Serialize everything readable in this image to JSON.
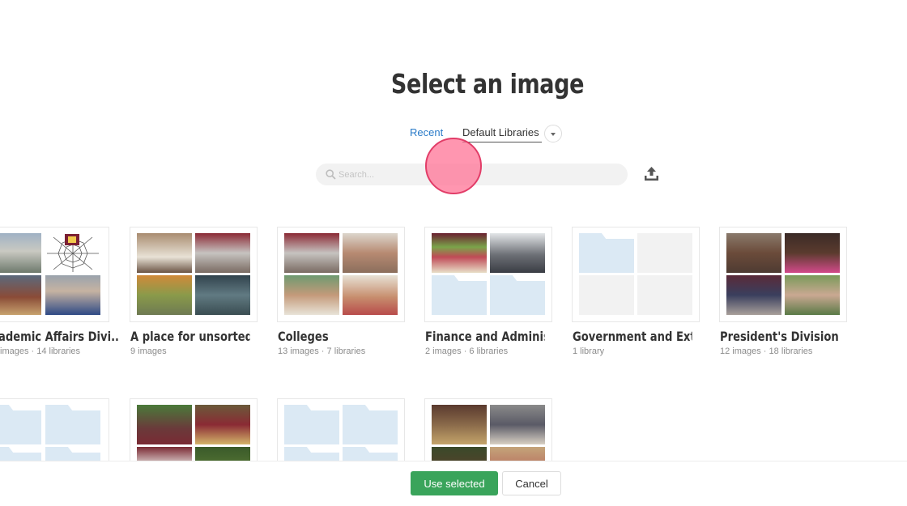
{
  "header": {
    "title": "Select an image"
  },
  "tabs": {
    "recent": "Recent",
    "default_libraries": "Default Libraries"
  },
  "search": {
    "placeholder": "Search..."
  },
  "libraries": [
    {
      "title": "Academic Affairs Division",
      "display_title": "ademic Affairs Divi...",
      "meta": "images · 14 libraries"
    },
    {
      "title": "A place for unsorted images",
      "display_title": "A place for unsorted i...",
      "meta": "9 images"
    },
    {
      "title": "Colleges",
      "display_title": "Colleges",
      "meta": "13 images · 7 libraries"
    },
    {
      "title": "Finance and Administration",
      "display_title": "Finance and Administ...",
      "meta": "2 images · 6 libraries"
    },
    {
      "title": "Government and External Relations",
      "display_title": "Government and Exte...",
      "meta": "1 library"
    },
    {
      "title": "President's Division",
      "display_title": "President's Division",
      "meta": "12 images · 18 libraries"
    }
  ],
  "footer": {
    "use_selected": "Use selected",
    "cancel": "Cancel"
  },
  "colors": {
    "accent": "#2a7bc8",
    "primary_button": "#3aa45b",
    "folder": "#dbe9f4"
  }
}
